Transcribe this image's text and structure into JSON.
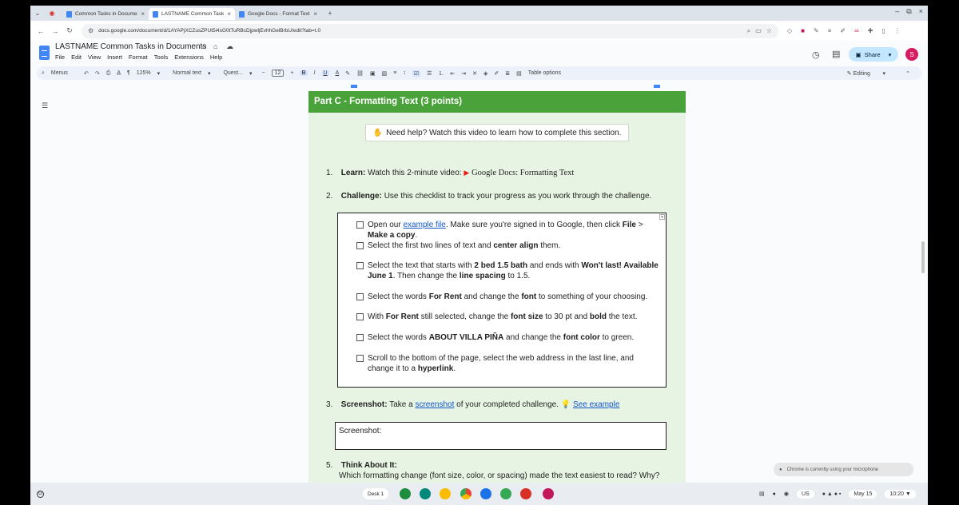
{
  "browser": {
    "tabs": [
      {
        "title": "Common Tasks in Document"
      },
      {
        "title": "LASTNAME Common Tasks in"
      },
      {
        "title": "Google Docs - Format Text.do"
      }
    ],
    "url": "docs.google.com/document/d/1AYAPjXCZusZPUt5i4sG0tTuRBcDjpwljEvhhGelBrbU/edit?tab=t.0"
  },
  "doc": {
    "title": "LASTNAME Common Tasks in Documents",
    "menu": [
      "File",
      "Edit",
      "View",
      "Insert",
      "Format",
      "Tools",
      "Extensions",
      "Help"
    ],
    "share_label": "Share",
    "avatar_letter": "S"
  },
  "toolbar": {
    "menus_label": "Menus",
    "zoom": "125%",
    "style": "Normal text",
    "font": "Quest...",
    "font_size": "12",
    "bold": "B",
    "italic": "I",
    "underline": "U",
    "text_color": "A",
    "table_options": "Table options",
    "editing_label": "Editing"
  },
  "content": {
    "section_title": "Part C - Formatting Text (3 points)",
    "help_text": "Need help? Watch this video to learn how to complete this section.",
    "step1": {
      "num": "1.",
      "label": "Learn:",
      "text": "Watch this 2-minute video:",
      "video": "Google Docs: Formatting Text"
    },
    "step2": {
      "num": "2.",
      "label": "Challenge:",
      "text": "Use this checklist to track your progress as you work through the challenge."
    },
    "checklist": [
      {
        "parts": [
          {
            "t": "Open our "
          },
          {
            "t": "example file",
            "link": true
          },
          {
            "t": ". Make sure you're signed in to Google, then click "
          },
          {
            "t": "File",
            "b": true
          },
          {
            "t": " > "
          },
          {
            "t": "Make a copy",
            "b": true
          },
          {
            "t": "."
          }
        ]
      },
      {
        "parts": [
          {
            "t": "Select the first two lines of text and "
          },
          {
            "t": "center align",
            "b": true
          },
          {
            "t": " them."
          }
        ]
      },
      {
        "parts": [
          {
            "t": "Select the text that starts with "
          },
          {
            "t": "2 bed 1.5 bath",
            "b": true
          },
          {
            "t": " and ends with "
          },
          {
            "t": "Won't last! Available June 1",
            "b": true
          },
          {
            "t": ". Then change the "
          },
          {
            "t": "line spacing",
            "b": true
          },
          {
            "t": " to 1.5."
          }
        ]
      },
      {
        "parts": [
          {
            "t": "Select the words "
          },
          {
            "t": "For Rent",
            "b": true
          },
          {
            "t": " and change the "
          },
          {
            "t": "font",
            "b": true
          },
          {
            "t": " to something of your choosing."
          }
        ]
      },
      {
        "parts": [
          {
            "t": "With "
          },
          {
            "t": "For Rent",
            "b": true
          },
          {
            "t": " still selected, change the "
          },
          {
            "t": "font size",
            "b": true
          },
          {
            "t": " to 30 pt and "
          },
          {
            "t": "bold",
            "b": true
          },
          {
            "t": " the text."
          }
        ]
      },
      {
        "parts": [
          {
            "t": "Select the words "
          },
          {
            "t": "ABOUT VILLA PIÑA",
            "b": true
          },
          {
            "t": " and change the "
          },
          {
            "t": "font color",
            "b": true
          },
          {
            "t": " to green."
          }
        ]
      },
      {
        "parts": [
          {
            "t": "Scroll to the bottom of the page, select the web address in the last line, and change it to a "
          },
          {
            "t": "hyperlink",
            "b": true
          },
          {
            "t": "."
          }
        ]
      }
    ],
    "step3": {
      "num": "3.",
      "label": "Screenshot:",
      "text1": "Take a",
      "link1": "screenshot",
      "text2": "of your completed challenge.",
      "link2": "See example"
    },
    "screenshot_box": "Screenshot:",
    "step5": {
      "num": "5.",
      "label": "Think About It:",
      "text": "Which formatting change (font size, color, or spacing) made the text easiest to read? Why?"
    }
  },
  "system": {
    "mic_notice": "Chrome is currently using your microphone",
    "desk_label": "Desk 1",
    "locale": "US",
    "date": "May 15",
    "time": "10:20"
  },
  "colors": {
    "section_green": "#4aa23a",
    "page_bg": "#e8f4e3",
    "link": "#1155cc",
    "share_bg": "#c2e7ff"
  }
}
